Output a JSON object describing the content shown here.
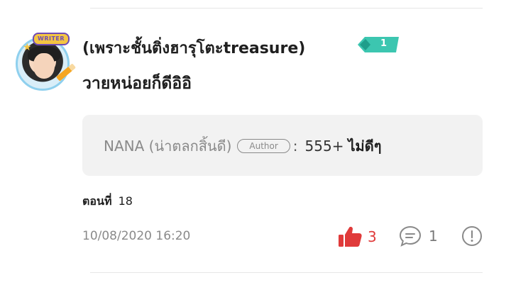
{
  "comment": {
    "avatar_badge": "WRITER",
    "username": "(เพราะชั้นติ่งฮารุโตะtreasure)",
    "level": "1",
    "text": "วายหน่อยก็ดีอิอิ",
    "reply": {
      "name": "NANA (น่าตลกสิ้นดี)",
      "author_tag": "Author",
      "colon": ":",
      "text": "555+",
      "text_bold": "ไม่ดีๆ"
    },
    "episode_label": "ตอนที่",
    "episode_number": "18",
    "timestamp": "10/08/2020 16:20",
    "like_count": "3",
    "reply_count": "1"
  },
  "colors": {
    "like": "#e03a3a",
    "level_badge": "#3cc6b0",
    "muted_text": "#8a8a8a",
    "reply_bg": "#f2f2f2"
  },
  "icons": {
    "like": "thumbs-up-icon",
    "reply": "speech-bubble-icon",
    "report": "exclamation-circle-icon",
    "level": "level-tag-icon"
  }
}
